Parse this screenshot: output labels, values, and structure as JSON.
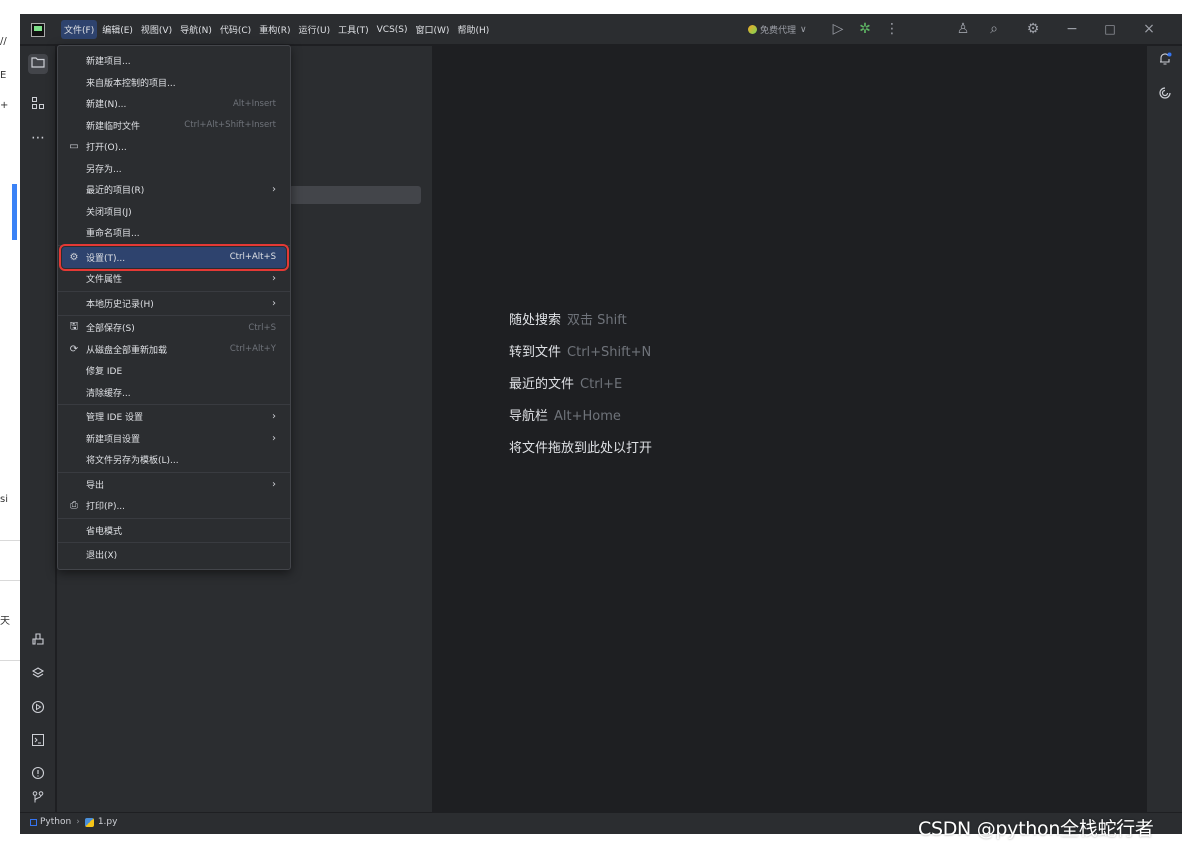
{
  "left_strip": {
    "fragments": [
      "//",
      "E",
      "+",
      "si",
      "天"
    ]
  },
  "menubar": {
    "items": [
      {
        "label": "文件(F)",
        "active": true
      },
      {
        "label": "编辑(E)"
      },
      {
        "label": "视图(V)"
      },
      {
        "label": "导航(N)"
      },
      {
        "label": "代码(C)"
      },
      {
        "label": "重构(R)"
      },
      {
        "label": "运行(U)"
      },
      {
        "label": "工具(T)"
      },
      {
        "label": "VCS(S)"
      },
      {
        "label": "窗口(W)"
      },
      {
        "label": "帮助(H)"
      }
    ]
  },
  "toolbar": {
    "proxy_label": "免费代理",
    "chevron": "∨",
    "run": "▷",
    "debug": "✲",
    "more": "⋮",
    "add_user": "♙",
    "search": "⌕",
    "settings": "⚙",
    "minimize": "−",
    "maximize": "□",
    "close": "×"
  },
  "file_menu": {
    "items": [
      {
        "id": "new-project",
        "label": "新建项目..."
      },
      {
        "id": "from-vcs",
        "label": "来自版本控制的项目..."
      },
      {
        "id": "new",
        "label": "新建(N)...",
        "shortcut": "Alt+Insert"
      },
      {
        "id": "new-scratch",
        "label": "新建临时文件",
        "shortcut": "Ctrl+Alt+Shift+Insert"
      },
      {
        "id": "open",
        "label": "打开(O)...",
        "icon": "▭"
      },
      {
        "id": "save-as",
        "label": "另存为..."
      },
      {
        "id": "recent",
        "label": "最近的项目(R)",
        "submenu": true
      },
      {
        "id": "close-project",
        "label": "关闭项目(J)"
      },
      {
        "id": "rename-project",
        "label": "重命名项目..."
      },
      {
        "id": "settings",
        "label": "设置(T)...",
        "shortcut": "Ctrl+Alt+S",
        "icon": "⚙"
      },
      {
        "id": "file-properties",
        "label": "文件属性",
        "submenu": true
      },
      {
        "id": "local-history",
        "label": "本地历史记录(H)",
        "submenu": true
      },
      {
        "id": "save-all",
        "label": "全部保存(S)",
        "shortcut": "Ctrl+S",
        "icon": "🖫"
      },
      {
        "id": "reload",
        "label": "从磁盘全部重新加载",
        "shortcut": "Ctrl+Alt+Y",
        "icon": "⟳"
      },
      {
        "id": "repair-ide",
        "label": "修复 IDE"
      },
      {
        "id": "invalidate-caches",
        "label": "清除缓存..."
      },
      {
        "id": "manage-ide-settings",
        "label": "管理 IDE 设置",
        "submenu": true
      },
      {
        "id": "new-project-settings",
        "label": "新建项目设置",
        "submenu": true
      },
      {
        "id": "save-as-template",
        "label": "将文件另存为模板(L)..."
      },
      {
        "id": "export",
        "label": "导出",
        "submenu": true
      },
      {
        "id": "print",
        "label": "打印(P)...",
        "icon": "⎙"
      },
      {
        "id": "power-save",
        "label": "省电模式"
      },
      {
        "id": "exit",
        "label": "退出(X)"
      }
    ]
  },
  "editor_hints": [
    {
      "label": "随处搜索",
      "shortcut": "双击 Shift"
    },
    {
      "label": "转到文件",
      "shortcut": "Ctrl+Shift+N"
    },
    {
      "label": "最近的文件",
      "shortcut": "Ctrl+E"
    },
    {
      "label": "导航栏",
      "shortcut": "Alt+Home"
    },
    {
      "label": "将文件拖放到此处以打开",
      "shortcut": ""
    }
  ],
  "statusbar": {
    "project": "Python",
    "separator": "›",
    "file": "1.py"
  },
  "watermark": "CSDN @python全栈蛇行者",
  "colors": {
    "accent": "#3574f0",
    "highlight": "#2e436e",
    "highlight_border": "#e53935",
    "panel": "#2b2d30",
    "editor": "#1e1f22"
  }
}
